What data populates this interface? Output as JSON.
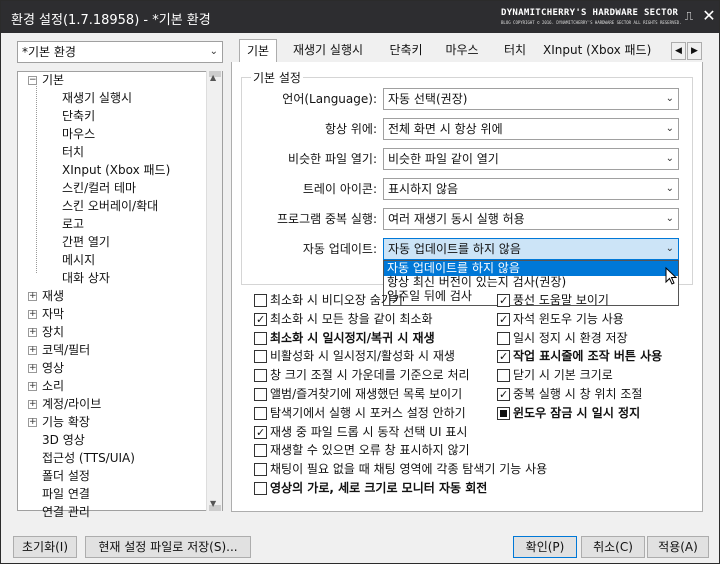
{
  "window": {
    "title": "환경 설정(1.7.18958) - *기본 환경"
  },
  "brand": {
    "name": "DYNAMITCHERRY'S HARDWARE SECTOR",
    "tagline": "BLOG COPYRIGHT © 2016. DYNAMITCHERRY'S HARDWARE SECTOR ALL RIGHTS RESERVED."
  },
  "profile_select": {
    "value": "*기본 환경"
  },
  "tree": {
    "items": [
      {
        "label": "기본",
        "level": 0,
        "expander": "minus"
      },
      {
        "label": "재생기 실행시",
        "level": 1
      },
      {
        "label": "단축키",
        "level": 1
      },
      {
        "label": "마우스",
        "level": 1
      },
      {
        "label": "터치",
        "level": 1
      },
      {
        "label": "XInput (Xbox 패드)",
        "level": 1
      },
      {
        "label": "스킨/컬러 테마",
        "level": 1
      },
      {
        "label": "스킨 오버레이/확대",
        "level": 1
      },
      {
        "label": "로고",
        "level": 1
      },
      {
        "label": "간편 열기",
        "level": 1
      },
      {
        "label": "메시지",
        "level": 1
      },
      {
        "label": "대화 상자",
        "level": 1
      },
      {
        "label": "재생",
        "level": 0,
        "expander": "plus"
      },
      {
        "label": "자막",
        "level": 0,
        "expander": "plus"
      },
      {
        "label": "장치",
        "level": 0,
        "expander": "plus"
      },
      {
        "label": "코덱/필터",
        "level": 0,
        "expander": "plus"
      },
      {
        "label": "영상",
        "level": 0,
        "expander": "plus"
      },
      {
        "label": "소리",
        "level": 0,
        "expander": "plus"
      },
      {
        "label": "계정/라이브",
        "level": 0,
        "expander": "plus"
      },
      {
        "label": "기능 확장",
        "level": 0,
        "expander": "plus"
      },
      {
        "label": "3D 영상",
        "level": 0
      },
      {
        "label": "접근성 (TTS/UIA)",
        "level": 0
      },
      {
        "label": "폴더 설정",
        "level": 0
      },
      {
        "label": "파일 연결",
        "level": 0
      },
      {
        "label": "연결 관리",
        "level": 0
      }
    ]
  },
  "tabs": [
    {
      "label": "기본",
      "active": true
    },
    {
      "label": "재생기 실행시"
    },
    {
      "label": "단축키"
    },
    {
      "label": "마우스"
    },
    {
      "label": "터치"
    },
    {
      "label": "XInput (Xbox 패드)"
    }
  ],
  "icons": {
    "tab_left": "triangle-left-icon",
    "tab_right": "triangle-right-icon",
    "pin": "pin-icon",
    "close": "close-icon",
    "dropdown": "chevron-down-icon"
  },
  "group": {
    "title": "기본 설정"
  },
  "settings": [
    {
      "label": "언어(Language):",
      "value": "자동 선택(권장)"
    },
    {
      "label": "항상 위에:",
      "value": "전체 화면 시 항상 위에"
    },
    {
      "label": "비슷한 파일 열기:",
      "value": "비슷한 파일 같이 열기"
    },
    {
      "label": "트레이 아이콘:",
      "value": "표시하지 않음"
    },
    {
      "label": "프로그램 중복 실행:",
      "value": "여러 재생기 동시 실행 허용"
    },
    {
      "label": "자동 업데이트:",
      "value": "자동 업데이트를 하지 않음"
    }
  ],
  "update_options": [
    {
      "label": "자동 업데이트를 하지 않음",
      "selected": true
    },
    {
      "label": "항상 최신 버전이 있는지 검사(권장)"
    },
    {
      "label": "일주일 뒤에 검사"
    }
  ],
  "checkboxes_left": [
    {
      "label": "최소화 시 비디오장 숨기기",
      "state": "unchecked"
    },
    {
      "label": "최소화 시 모든 창을 같이 최소화",
      "state": "checked"
    },
    {
      "label": "최소화 시 일시정지/복귀 시 재생",
      "state": "unchecked",
      "bold": true
    },
    {
      "label": "비활성화 시 일시정지/활성화 시 재생",
      "state": "unchecked"
    },
    {
      "label": "창 크기 조절 시 가운데를 기준으로 처리",
      "state": "unchecked"
    },
    {
      "label": "앨범/즐겨찾기에 재생했던 목록 보이기",
      "state": "unchecked"
    },
    {
      "label": "탐색기에서 실행 시 포커스 설정 안하기",
      "state": "unchecked"
    },
    {
      "label": "재생 중 파일 드롭 시 동작 선택 UI 표시",
      "state": "checked"
    },
    {
      "label": "재생할 수 있으면 오류 창 표시하지 않기",
      "state": "unchecked"
    },
    {
      "label": "채팅이 필요 없을 때 채팅 영역에 각종 탐색기 기능 사용",
      "state": "unchecked"
    },
    {
      "label": "영상의 가로, 세로 크기로 모니터 자동 회전",
      "state": "unchecked",
      "bold": true
    }
  ],
  "checkboxes_right": [
    {
      "label": "풍선 도움말 보이기",
      "state": "checked"
    },
    {
      "label": "자석 윈도우 기능 사용",
      "state": "checked"
    },
    {
      "label": "일시 정지 시 환경 저장",
      "state": "unchecked"
    },
    {
      "label": "작업 표시줄에 조작 버튼 사용",
      "state": "checked",
      "bold": true
    },
    {
      "label": "닫기 시 기본 크기로",
      "state": "unchecked"
    },
    {
      "label": "중복 실행 시 창 위치 조절",
      "state": "checked"
    },
    {
      "label": "윈도우 잠금 시 일시 정지",
      "state": "mixed",
      "bold": true
    }
  ],
  "buttons": {
    "reset": "초기화(I)",
    "save_file": "현재 설정 파일로 저장(S)...",
    "ok": "확인(P)",
    "cancel": "취소(C)",
    "apply": "적용(A)"
  }
}
